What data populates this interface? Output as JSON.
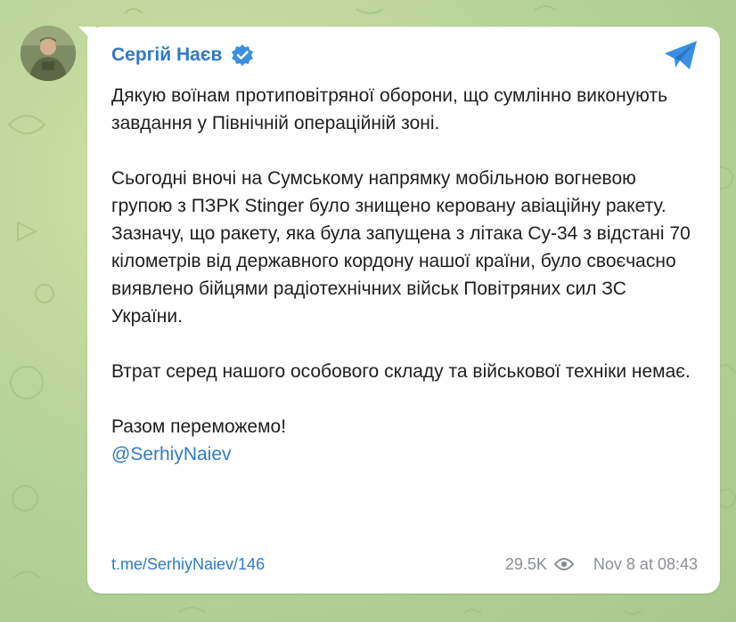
{
  "post": {
    "author": "Сергій Наєв",
    "paragraphs": [
      "Дякую воїнам протиповітряної оборони, що сумлінно виконують завдання у Північній операційній зоні.",
      "Сьогодні вночі на Сумському напрямку мобільною вогневою групою з ПЗРК Stinger було знищено керовану авіаційну ракету. Зазначу, що ракету, яка була запущена з літака Су-34 з відстані 70 кілометрів від державного кордону нашої країни, було своєчасно виявлено бійцями радіотехнічних військ Повітряних сил ЗС України.",
      "Втрат серед нашого особового складу та військової техніки немає."
    ],
    "closing": "Разом переможемо!",
    "mention": "@SerhiyNaiev",
    "link": "t.me/SerhiyNaiev/146",
    "views": "29.5K",
    "timestamp": "Nov 8 at 08:43"
  },
  "icons": {
    "verified": "verified-badge-icon",
    "share": "telegram-plane-icon",
    "views": "eye-icon"
  },
  "colors": {
    "accent": "#2f7ac8",
    "text": "#1f1f1f",
    "muted": "#8b8f94",
    "background": "#b9d39a"
  }
}
